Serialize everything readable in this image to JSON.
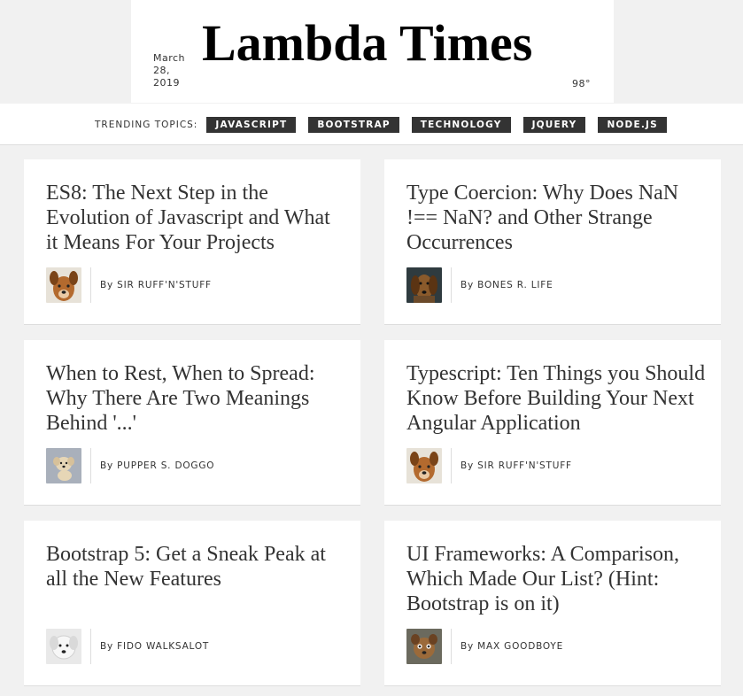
{
  "header": {
    "date": "March 28, 2019",
    "title": "Lambda Times",
    "temp": "98°"
  },
  "topics": {
    "label": "TRENDING TOPICS:",
    "items": [
      "JAVASCRIPT",
      "BOOTSTRAP",
      "TECHNOLOGY",
      "JQUERY",
      "NODE.JS"
    ]
  },
  "articles": [
    {
      "headline": "ES8: The Next Step in the Evolution of Javascript and What it Means For Your Projects",
      "byline": "By SIR RUFF'N'STUFF",
      "avatar": "dog-avatar-icon"
    },
    {
      "headline": "Type Coercion: Why Does NaN !== NaN? and Other Strange Occurrences",
      "byline": "By BONES R. LIFE",
      "avatar": "dog-avatar-icon"
    },
    {
      "headline": "When to Rest, When to Spread: Why There Are Two Meanings Behind '...'",
      "byline": "By PUPPER S. DOGGO",
      "avatar": "dog-avatar-icon"
    },
    {
      "headline": "Typescript: Ten Things you Should Know Before Building Your Next Angular Application",
      "byline": "By SIR RUFF'N'STUFF",
      "avatar": "dog-avatar-icon"
    },
    {
      "headline": "Bootstrap 5: Get a Sneak Peak at all the New Features",
      "byline": "By FIDO WALKSALOT",
      "avatar": "dog-avatar-icon"
    },
    {
      "headline": "UI Frameworks: A Comparison, Which Made Our List? (Hint: Bootstrap is on it)",
      "byline": "By MAX GOODBOYE",
      "avatar": "dog-avatar-icon"
    }
  ]
}
